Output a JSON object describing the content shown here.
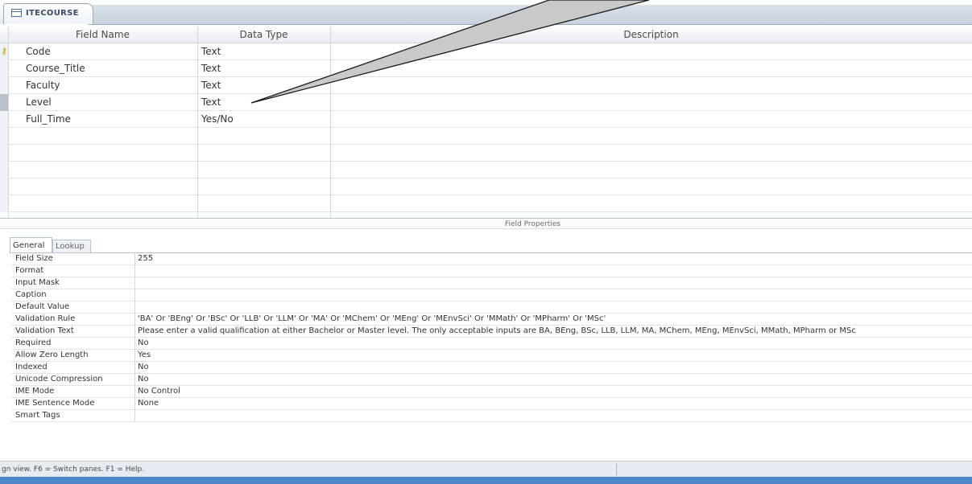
{
  "tab": {
    "title": "ITECOURSE"
  },
  "grid": {
    "headers": {
      "field_name": "Field Name",
      "data_type": "Data Type",
      "description": "Description"
    },
    "rows": [
      {
        "name": "Code",
        "type": "Text",
        "key": true
      },
      {
        "name": "Course_Title",
        "type": "Text"
      },
      {
        "name": "Faculty",
        "type": "Text"
      },
      {
        "name": "Level",
        "type": "Text",
        "selected": true
      },
      {
        "name": "Full_Time",
        "type": "Yes/No"
      },
      {
        "name": "",
        "type": ""
      },
      {
        "name": "",
        "type": ""
      },
      {
        "name": "",
        "type": ""
      },
      {
        "name": "",
        "type": ""
      },
      {
        "name": "",
        "type": ""
      }
    ]
  },
  "field_properties_label": "Field Properties",
  "property_tabs": {
    "general": "General",
    "lookup": "Lookup"
  },
  "properties": [
    {
      "label": "Field Size",
      "value": "255"
    },
    {
      "label": "Format",
      "value": ""
    },
    {
      "label": "Input Mask",
      "value": ""
    },
    {
      "label": "Caption",
      "value": ""
    },
    {
      "label": "Default Value",
      "value": ""
    },
    {
      "label": "Validation Rule",
      "value": "'BA' Or 'BEng' Or 'BSc' Or 'LLB' Or 'LLM' Or 'MA' Or 'MChem' Or 'MEng' Or 'MEnvSci' Or 'MMath' Or 'MPharm' Or 'MSc'"
    },
    {
      "label": "Validation Text",
      "value": "Please enter a valid qualification at either Bachelor or Master level. The only acceptable inputs are BA, BEng, BSc, LLB, LLM, MA, MChem, MEng, MEnvSci, MMath, MPharm or MSc"
    },
    {
      "label": "Required",
      "value": "No"
    },
    {
      "label": "Allow Zero Length",
      "value": "Yes"
    },
    {
      "label": "Indexed",
      "value": "No"
    },
    {
      "label": "Unicode Compression",
      "value": "No"
    },
    {
      "label": "IME Mode",
      "value": "No Control"
    },
    {
      "label": "IME Sentence Mode",
      "value": "None"
    },
    {
      "label": "Smart Tags",
      "value": ""
    }
  ],
  "status": {
    "text": "gn view.  F6 = Switch panes.  F1 = Help."
  },
  "colors": {
    "accent": "#4a86c8",
    "selector_selected": "#b9c2cc",
    "callout_fill": "#c9c9c9"
  }
}
